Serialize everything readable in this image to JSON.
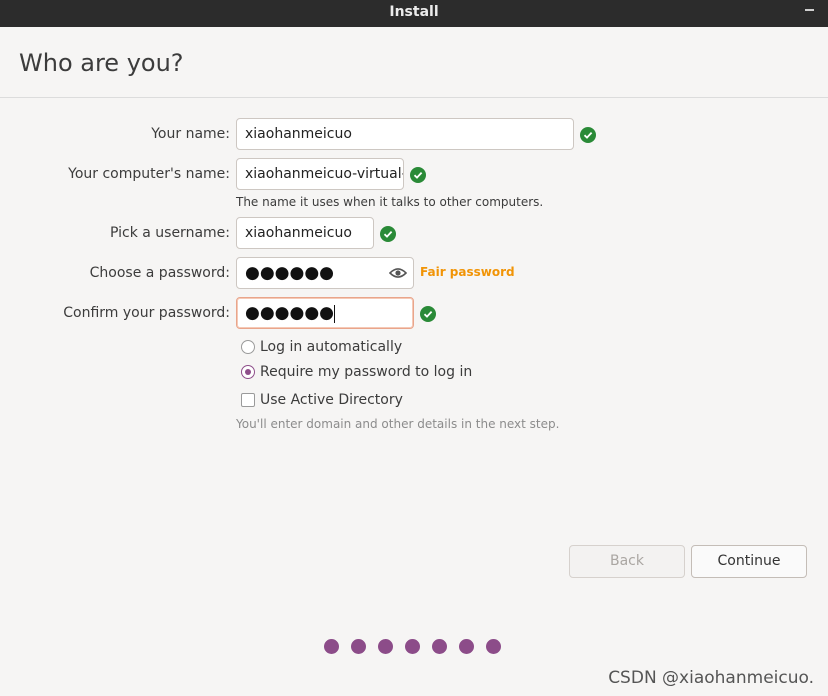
{
  "window": {
    "title": "Install"
  },
  "page": {
    "title": "Who are you?"
  },
  "form": {
    "name": {
      "label": "Your name:",
      "value": "xiaohanmeicuo"
    },
    "computer": {
      "label": "Your computer's name:",
      "value": "xiaohanmeicuo-virtual-",
      "hint": "The name it uses when it talks to other computers."
    },
    "username": {
      "label": "Pick a username:",
      "value": "xiaohanmeicuo"
    },
    "password": {
      "label": "Choose a password:",
      "value": "●●●●●●",
      "strength": "Fair password"
    },
    "confirm": {
      "label": "Confirm your password:",
      "value": "●●●●●●"
    }
  },
  "options": {
    "auto_login": {
      "label": "Log in automatically",
      "selected": false
    },
    "require_password": {
      "label": "Require my password to log in",
      "selected": true
    },
    "active_directory": {
      "label": "Use Active Directory",
      "checked": false,
      "hint": "You'll enter domain and other details in the next step."
    }
  },
  "buttons": {
    "back": "Back",
    "continue": "Continue"
  },
  "progress": {
    "total_steps": 7
  },
  "watermark": "CSDN @xiaohanmeicuo.",
  "colors": {
    "accent": "#8c4c89",
    "valid": "#2a8a37",
    "warning": "#f19406"
  }
}
